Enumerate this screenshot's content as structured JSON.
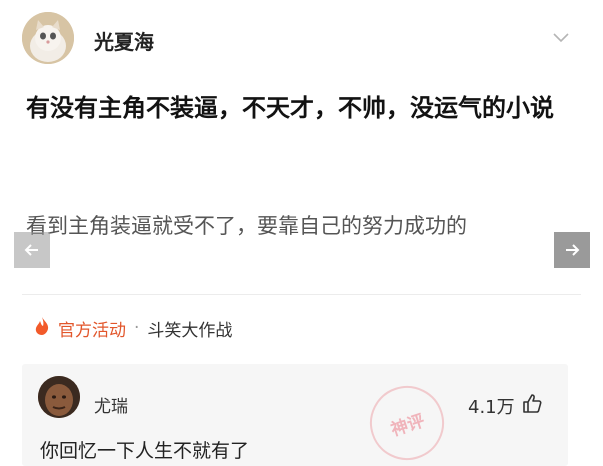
{
  "post": {
    "author": "光夏海",
    "title": "有没有主角不装逼，不天才，不帅，没运气的小说",
    "summary": "看到主角装逼就受不了，要靠自己的努力成功的"
  },
  "activity": {
    "tag": "官方活动",
    "separator": "·",
    "topic": "斗笑大作战"
  },
  "comment": {
    "author": "尤瑞",
    "likes": "4.1万",
    "text": "你回忆一下人生不就有了",
    "stamp": "神评"
  },
  "icons": {
    "chevron": "chevron-down-icon",
    "prev": "arrow-left-icon",
    "next": "arrow-right-icon",
    "fire": "fire-icon",
    "like": "thumbs-up-icon"
  },
  "colors": {
    "accent": "#e2562b",
    "nav": "#9a9a9a"
  }
}
